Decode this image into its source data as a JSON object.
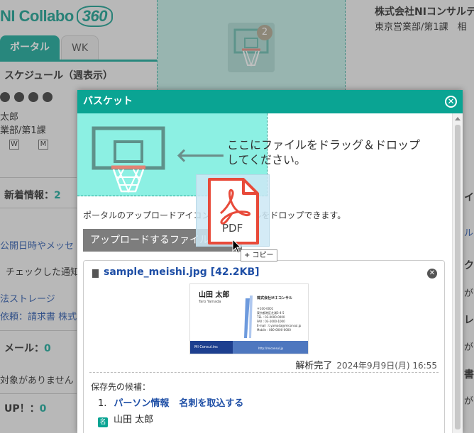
{
  "app": {
    "logo_text": "NI Collabo",
    "logo_version": "360"
  },
  "header": {
    "company": "株式会社NIコンサルテ",
    "department": "東京営業部/第1課　相",
    "basket_count": "2"
  },
  "tabs": [
    {
      "label": "ポータル"
    },
    {
      "label": "WK"
    }
  ],
  "background": {
    "schedule_title": "スケジュール（週表示）",
    "user_name": "太郎",
    "user_dept": "業部/第1課",
    "w_marks": [
      "W",
      "M"
    ],
    "news_label": "新着情報：",
    "news_count": "2",
    "public_link": "公開日時やメッセ",
    "checked_text": "チェックした通知",
    "storage_link": "法ストレージ",
    "request_link": "依頼：請求書 株式",
    "mail_label": "メール：",
    "mail_count": "0",
    "none_text": "対象がありません",
    "up_label": "UP！：",
    "up_count": "0",
    "right_chars": [
      "イ",
      "ル",
      "ク",
      "が",
      "レ",
      "が",
      "書",
      "が"
    ]
  },
  "modal": {
    "title": "バスケット",
    "drop_text_line1": "ここにファイルをドラッグ＆ドロップ",
    "drop_text_line2": "してください。",
    "hint": "ポータルのアップロードアイコンにもファイルをドロップできます。",
    "upload_button": "アップロードするファイルを選択",
    "file": {
      "name": "sample_meishi.jpg [42.2KB]",
      "status": "解析完了",
      "timestamp": "2024年9月9日(月) 16:55",
      "candidates_label": "保存先の候補：",
      "candidate_number": "1.",
      "candidate_link1": "パーソン情報",
      "candidate_link2": "名刺を取込する",
      "person_name": "山田 太郎"
    },
    "card_preview": {
      "name": "山田 太郎",
      "romaji": "Taro Yamada",
      "company": "株式会社ＭＩコンサル",
      "lines": [
        "〒100-0001",
        "東京都港区芝浦3-4-5",
        "TEL : 03-0000-0000",
        "FAX : 03-1000-1000",
        "E-mail : t.yamada@miconsul.jp",
        "Mobile : 080-0000-0000"
      ],
      "footer": "MI Consul.inc",
      "url": "http://miconsul.jp"
    }
  },
  "drag": {
    "pdf_label": "PDF",
    "copy_label": "+ コピー"
  },
  "colors": {
    "accent": "#0aa493",
    "link": "#1f4fa6",
    "drop_zone": "#8cf0e3",
    "pdf_red": "#e84a3a"
  }
}
